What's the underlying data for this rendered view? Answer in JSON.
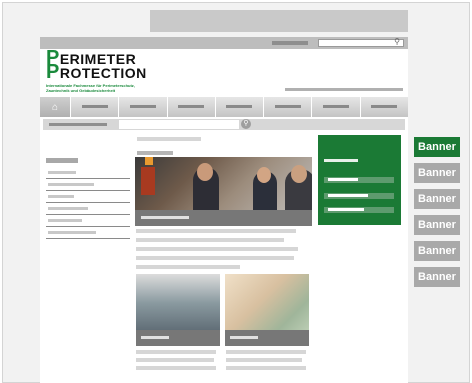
{
  "logo": {
    "line1_cap": "P",
    "line1_rest": "ERIMETER",
    "line2_cap": "P",
    "line2_rest": "ROTECTION",
    "tagline1": "Internationale Fachmesse für Perimeterschutz,",
    "tagline2": "Zauntechnik und Gebäudesicherheit"
  },
  "banners": [
    {
      "label": "Banner",
      "active": true
    },
    {
      "label": "Banner",
      "active": false
    },
    {
      "label": "Banner",
      "active": false
    },
    {
      "label": "Banner",
      "active": false
    },
    {
      "label": "Banner",
      "active": false
    },
    {
      "label": "Banner",
      "active": false
    }
  ],
  "icons": {
    "home": "home-icon",
    "search": "search-icon"
  },
  "colors": {
    "accent": "#1b7a35",
    "banner_inactive": "#a9a9a9"
  }
}
